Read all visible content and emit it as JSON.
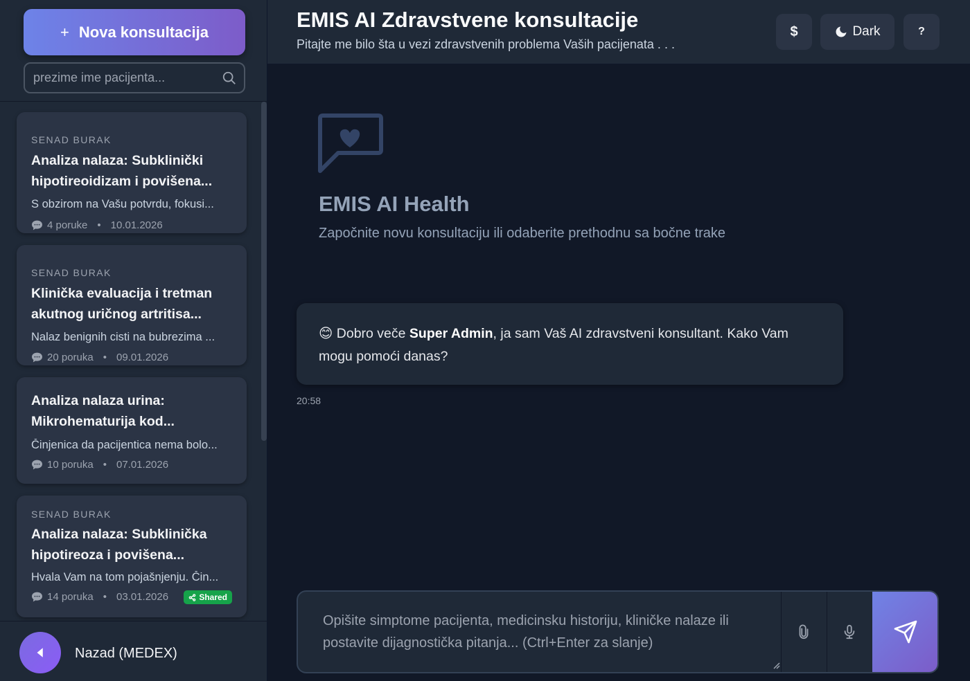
{
  "sidebar": {
    "new_button_label": "Nova konsultacija",
    "search_placeholder": "prezime ime pacijenta...",
    "conversations": [
      {
        "patient": "SENAD BURAK",
        "title_line1": "Analiza nalaza: Subklinički",
        "title_line2": "hipotireoidizam i povišena...",
        "preview": "S obzirom na Vašu potvrdu, fokusi...",
        "messages": "4 poruke",
        "date": "10.01.2026"
      },
      {
        "patient": "SENAD BURAK",
        "title_line1": "Klinička evaluacija i tretman",
        "title_line2": "akutnog uričnog artritisa...",
        "preview": "Nalaz benignih cisti na bubrezima ...",
        "messages": "20 poruka",
        "date": "09.01.2026"
      },
      {
        "patient": "",
        "title_line1": "Analiza nalaza urina:",
        "title_line2": "Mikrohematurija kod...",
        "preview": "Činjenica da pacijentica nema bolo...",
        "messages": "10 poruka",
        "date": "07.01.2026"
      },
      {
        "patient": "SENAD BURAK",
        "title_line1": "Analiza nalaza: Subklinička",
        "title_line2": "hipotireoza i povišena...",
        "preview": "Hvala Vam na tom pojašnjenju. Čin...",
        "messages": "14 poruka",
        "date": "03.01.2026",
        "badge": "Shared"
      }
    ],
    "back_label": "Nazad (MEDEX)"
  },
  "header": {
    "title": "EMIS AI Zdravstvene konsultacije",
    "subtitle": "Pitajte me bilo šta u vezi zdravstvenih problema Vaših pacijenata . . .",
    "dollar_label": "$",
    "theme_label": "Dark",
    "help_label": "?"
  },
  "welcome": {
    "title": "EMIS AI Health",
    "subtitle": "Započnite novu konsultaciju ili odaberite prethodnu sa bočne trake"
  },
  "message": {
    "emoji": "😊",
    "greeting": "Dobro veče ",
    "user": "Super Admin",
    "text": ", ja sam Vaš AI zdravstveni konsultant. Kako Vam mogu pomoći danas?",
    "time": "20:58"
  },
  "composer": {
    "placeholder": "Opišite simptome pacijenta, medicinsku historiju, kliničke nalaze ili postavite dijagnostička pitanja... (Ctrl+Enter za slanje)"
  },
  "colors": {
    "accent_start": "#6d83e8",
    "accent_end": "#7d5cc9",
    "shared_badge": "#16a34a"
  }
}
